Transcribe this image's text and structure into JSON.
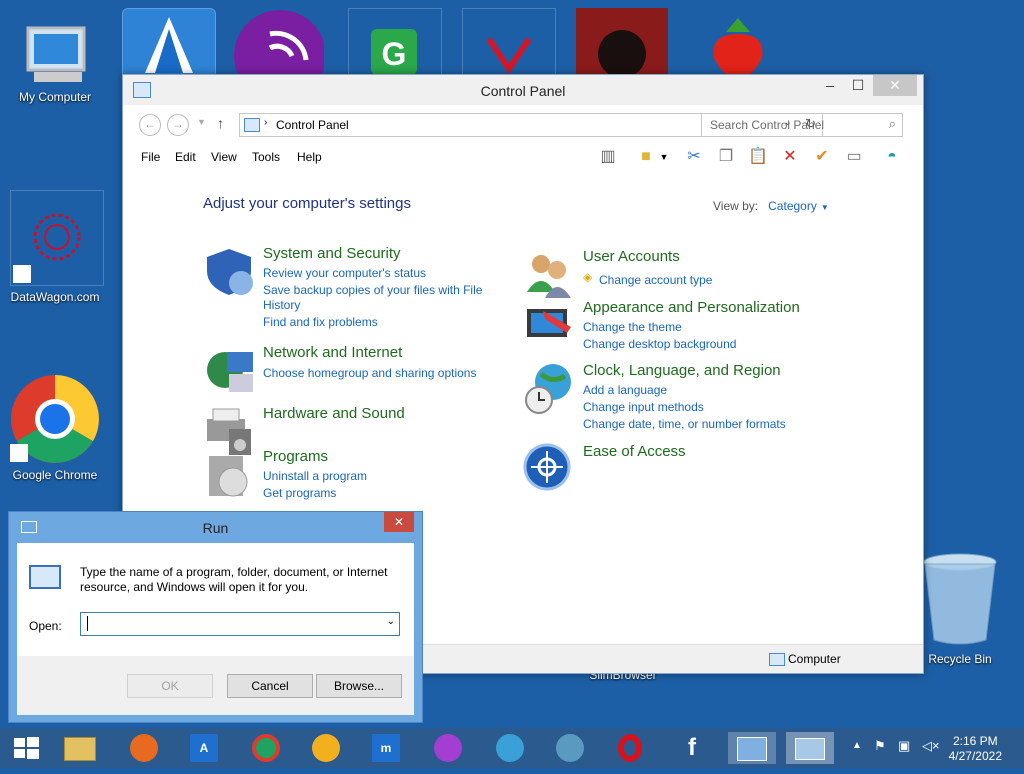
{
  "desktop": {
    "icons": [
      {
        "label": "My Computer"
      },
      {
        "label": "DataWagon.com"
      },
      {
        "label": "Google Chrome"
      },
      {
        "label": "Recycle Bin"
      },
      {
        "label": "SlimBrowser"
      }
    ]
  },
  "control_panel": {
    "title": "Control Panel",
    "address": "Control Panel",
    "search_placeholder": "Search Control Panel",
    "menu": [
      "File",
      "Edit",
      "View",
      "Tools",
      "Help"
    ],
    "heading": "Adjust your computer's settings",
    "view_by_label": "View by:",
    "view_by_value": "Category",
    "categories": [
      {
        "title": "System and Security",
        "links": [
          "Review your computer's status",
          "Save backup copies of your files with File",
          "History",
          "Find and fix problems"
        ]
      },
      {
        "title": "Network and Internet",
        "links": [
          "Choose homegroup and sharing options"
        ]
      },
      {
        "title": "Hardware and Sound",
        "links": []
      },
      {
        "title": "Programs",
        "links": [
          "Uninstall a program",
          "Get programs"
        ]
      },
      {
        "title": "User Accounts",
        "links": [
          "Change account type"
        ]
      },
      {
        "title": "Appearance and Personalization",
        "links": [
          "Change the theme",
          "Change desktop background"
        ]
      },
      {
        "title": "Clock, Language, and Region",
        "links": [
          "Add a language",
          "Change input methods",
          "Change date, time, or number formats"
        ]
      },
      {
        "title": "Ease of Access",
        "links": []
      }
    ],
    "status": "Computer"
  },
  "run": {
    "title": "Run",
    "description_line1": "Type the name of a program, folder, document, or Internet",
    "description_line2": "resource, and Windows will open it for you.",
    "open_label": "Open:",
    "open_value": "",
    "ok_label": "OK",
    "cancel_label": "Cancel",
    "browse_label": "Browse..."
  },
  "taskbar": {
    "time": "2:16 PM",
    "date": "4/27/2022"
  }
}
